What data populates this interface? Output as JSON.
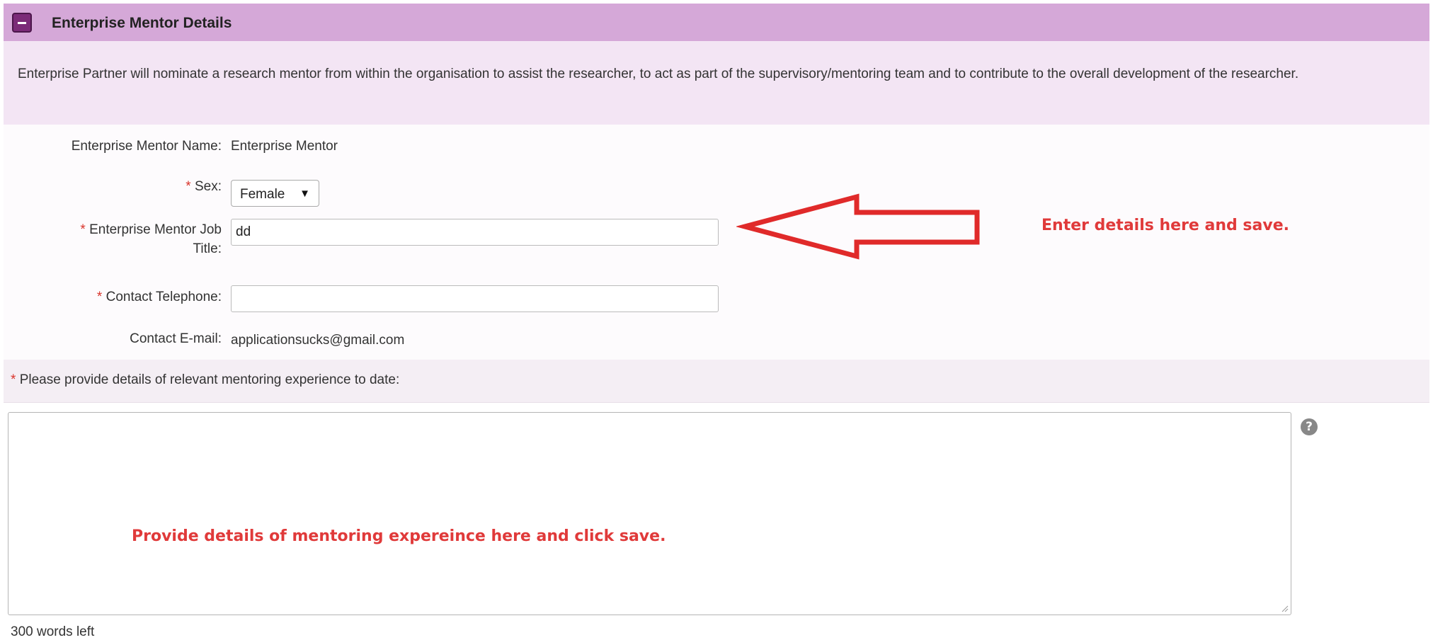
{
  "panel": {
    "title": "Enterprise Mentor Details",
    "description": "Enterprise Partner will nominate a research mentor from within the organisation to assist the researcher, to act as part of the supervisory/mentoring team and to contribute to the overall development of the researcher."
  },
  "form": {
    "required_mark": "*",
    "mentor_name": {
      "label": "Enterprise Mentor Name:",
      "value": "Enterprise Mentor"
    },
    "sex": {
      "label": "Sex:",
      "selected": "Female"
    },
    "job_title": {
      "label_line1": "Enterprise Mentor Job",
      "label_line2": "Title:",
      "value": "dd"
    },
    "telephone": {
      "label": "Contact Telephone:",
      "value": ""
    },
    "email": {
      "label": "Contact E-mail:",
      "value": "applicationsucks@gmail.com"
    },
    "experience": {
      "label": "Please provide details of relevant mentoring experience to date:",
      "words_left": "300 words left"
    }
  },
  "annotations": {
    "job_title_note": "Enter details here and save.",
    "experience_note": "Provide details of mentoring expereince here and click save."
  },
  "icons": {
    "toggle": "minus-icon",
    "help": "question-circle-icon",
    "help_glyph": "?",
    "select_caret": "▼"
  },
  "colors": {
    "header_bg": "#d5a8d8",
    "intro_bg": "#f3e5f4",
    "required": "#d9342b",
    "annotation": "#e03a3a"
  }
}
